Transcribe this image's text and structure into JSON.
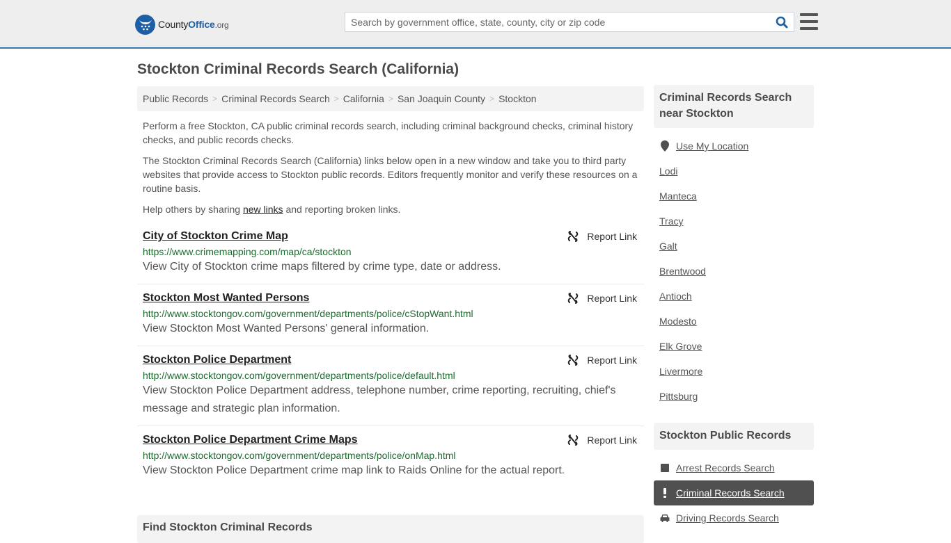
{
  "header": {
    "logo": {
      "brand_prefix": "County",
      "brand_main": "Office",
      "brand_suffix": ".org",
      "icon": "eagle-stars-icon"
    },
    "search": {
      "placeholder": "Search by government office, state, county, city or zip code",
      "value": ""
    },
    "search_icon": "search-icon",
    "menu_icon": "hamburger-menu-icon"
  },
  "page": {
    "title": "Stockton Criminal Records Search (California)"
  },
  "breadcrumb": [
    "Public Records",
    "Criminal Records Search",
    "California",
    "San Joaquin County",
    "Stockton"
  ],
  "intro": {
    "p1": "Perform a free Stockton, CA public criminal records search, including criminal background checks, criminal history checks, and public records checks.",
    "p2": "The Stockton Criminal Records Search (California) links below open in a new window and take you to third party websites that provide access to Stockton public records. Editors frequently monitor and verify these resources on a routine basis.",
    "p3_before": "Help others by sharing ",
    "p3_link": "new links",
    "p3_after": " and reporting broken links."
  },
  "results": [
    {
      "title": "City of Stockton Crime Map",
      "url": "https://www.crimemapping.com/map/ca/stockton",
      "description": "View City of Stockton crime maps filtered by crime type, date or address.",
      "report_label": "Report Link"
    },
    {
      "title": "Stockton Most Wanted Persons",
      "url": "http://www.stocktongov.com/government/departments/police/cStopWant.html",
      "description": "View Stockton Most Wanted Persons' general information.",
      "report_label": "Report Link"
    },
    {
      "title": "Stockton Police Department",
      "url": "http://www.stocktongov.com/government/departments/police/default.html",
      "description": "View Stockton Police Department address, telephone number, crime reporting, recruiting, chief's message and strategic plan information.",
      "report_label": "Report Link"
    },
    {
      "title": "Stockton Police Department Crime Maps",
      "url": "http://www.stocktongov.com/government/departments/police/onMap.html",
      "description": "View Stockton Police Department crime map link to Raids Online for the actual report.",
      "report_label": "Report Link"
    }
  ],
  "find_section": {
    "title": "Find Stockton Criminal Records"
  },
  "sidebar": {
    "nearby": {
      "title": "Criminal Records Search near Stockton",
      "use_location": "Use My Location",
      "cities": [
        "Lodi",
        "Manteca",
        "Tracy",
        "Galt",
        "Brentwood",
        "Antioch",
        "Modesto",
        "Elk Grove",
        "Livermore",
        "Pittsburg"
      ]
    },
    "public_records": {
      "title": "Stockton Public Records",
      "items": [
        {
          "label": "Arrest Records Search",
          "icon": "square-icon",
          "active": false
        },
        {
          "label": "Criminal Records Search",
          "icon": "exclamation-icon",
          "active": true
        },
        {
          "label": "Driving Records Search",
          "icon": "car-icon",
          "active": false
        }
      ]
    }
  },
  "colors": {
    "header_bg": "#eeeeee",
    "header_border": "#3a76a8",
    "brand_blue": "#1d5fa6",
    "url_green": "#1e6b2f",
    "active_item_bg": "#505050"
  }
}
